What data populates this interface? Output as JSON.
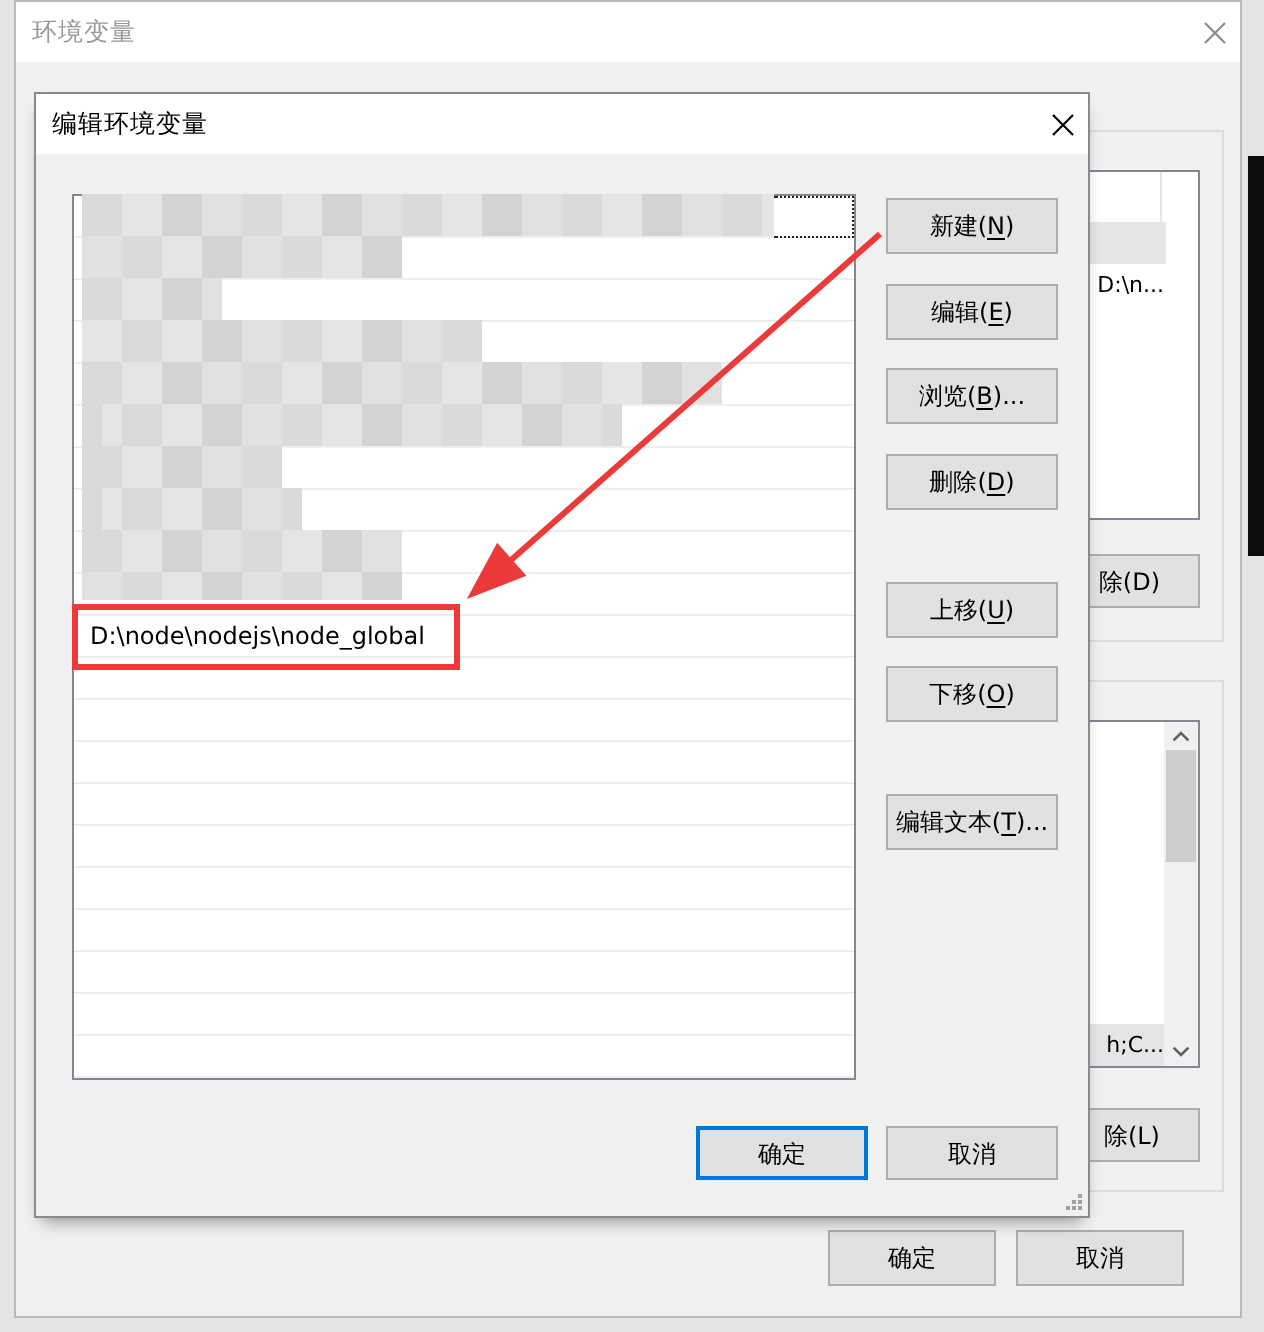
{
  "outer_window": {
    "title": "环境变量",
    "active": false,
    "user_variables": {
      "rows": [
        {
          "selected": true
        },
        {
          "selected": false,
          "value": "D:\\n..."
        }
      ],
      "delete_button": "除(D)"
    },
    "system_variables": {
      "rows": [
        {
          "selected": true,
          "value": "h;C..."
        }
      ],
      "delete_button": "除(L)"
    },
    "buttons": [
      {
        "label": "确定",
        "default": false
      },
      {
        "label": "取消",
        "default": false
      }
    ]
  },
  "edit_dialog": {
    "title": "编辑环境变量",
    "active": true,
    "entries": [
      {
        "kind": "redacted",
        "selected": true,
        "annotated": false
      },
      {
        "kind": "redacted",
        "selected": false,
        "annotated": false
      },
      {
        "kind": "redacted",
        "selected": false,
        "annotated": false
      },
      {
        "kind": "redacted",
        "selected": false,
        "annotated": false
      },
      {
        "kind": "redacted",
        "selected": false,
        "annotated": false
      },
      {
        "kind": "redacted",
        "selected": false,
        "annotated": false
      },
      {
        "kind": "redacted",
        "selected": false,
        "annotated": false
      },
      {
        "kind": "redacted",
        "selected": false,
        "annotated": false
      },
      {
        "kind": "redacted",
        "selected": false,
        "annotated": false
      },
      {
        "kind": "redacted",
        "selected": false,
        "annotated": false
      },
      {
        "kind": "path",
        "text": "D:\\node\\nodejs\\node_global",
        "selected": false,
        "annotated": true
      }
    ],
    "side_button_groups": [
      [
        {
          "label_start": "新建(",
          "access_key": "N",
          "label_end": ")"
        },
        {
          "label_start": "编辑(",
          "access_key": "E",
          "label_end": ")"
        },
        {
          "label_start": "浏览(",
          "access_key": "B",
          "label_end": ")..."
        },
        {
          "label_start": "删除(",
          "access_key": "D",
          "label_end": ")"
        }
      ],
      [
        {
          "label_start": "上移(",
          "access_key": "U",
          "label_end": ")"
        },
        {
          "label_start": "下移(",
          "access_key": "O",
          "label_end": ")"
        }
      ],
      [
        {
          "label_start": "编辑文本(",
          "access_key": "T",
          "label_end": ")..."
        }
      ]
    ],
    "buttons": [
      {
        "label": "确定",
        "default": true
      },
      {
        "label": "取消",
        "default": false
      }
    ]
  }
}
